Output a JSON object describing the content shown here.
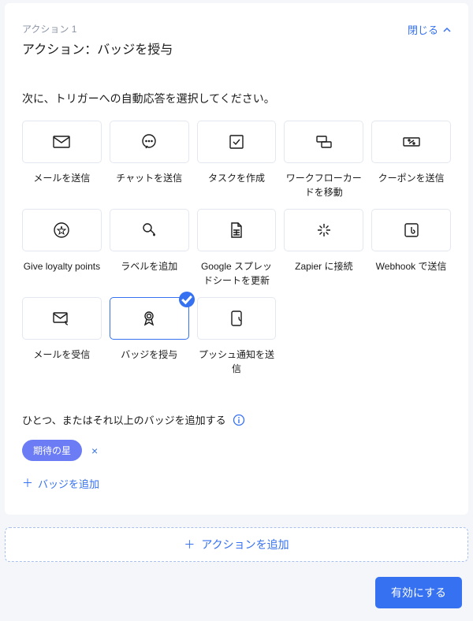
{
  "header": {
    "subtitle": "アクション 1",
    "title": "アクション：バッジを授与",
    "close": "閉じる"
  },
  "sectionTitle": "次に、トリガーへの自動応答を選択してください。",
  "options": [
    {
      "label": "メールを送信"
    },
    {
      "label": "チャットを送信"
    },
    {
      "label": "タスクを作成"
    },
    {
      "label": "ワークフローカードを移動"
    },
    {
      "label": "クーポンを送信"
    },
    {
      "label": "Give loyalty points"
    },
    {
      "label": "ラベルを追加"
    },
    {
      "label": "Google スプレッドシートを更新"
    },
    {
      "label": "Zapier に接続"
    },
    {
      "label": "Webhook で送信"
    },
    {
      "label": "メールを受信"
    },
    {
      "label": "バッジを授与"
    },
    {
      "label": "プッシュ通知を送信"
    }
  ],
  "badgeSection": {
    "title": "ひとつ、またはそれ以上のバッジを追加する",
    "chip": "期待の星",
    "addBadge": "バッジを追加"
  },
  "addAction": "アクションを追加",
  "enableBtn": "有効にする"
}
